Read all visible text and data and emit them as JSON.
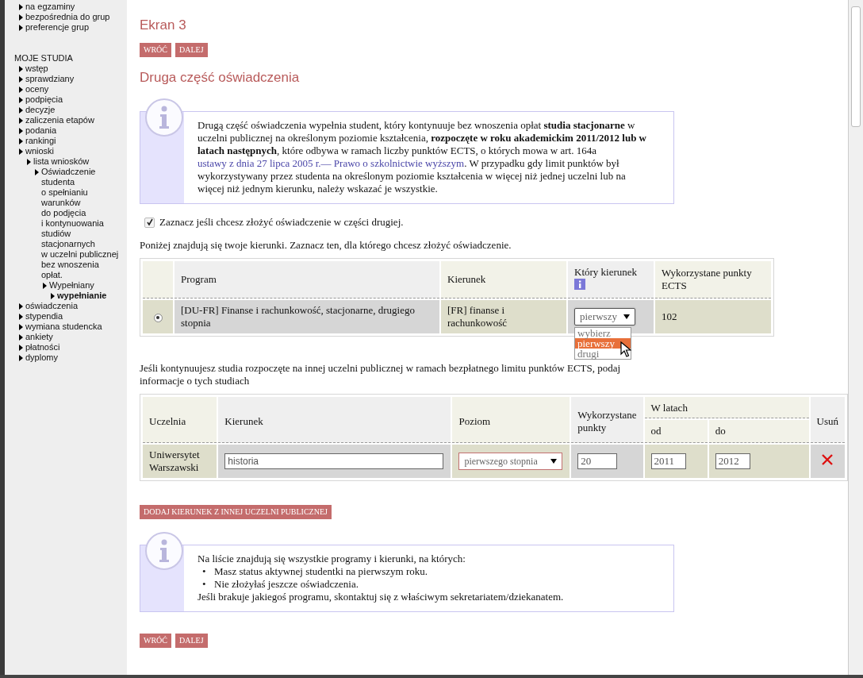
{
  "sidebar": {
    "top_items": [
      {
        "label": "na egzaminy",
        "selected": false
      },
      {
        "label": "bezpośrednia do grup",
        "selected": false
      },
      {
        "label": "preferencje grup",
        "selected": false
      }
    ],
    "section_title": "MOJE STUDIA",
    "items": [
      {
        "label": "wstęp",
        "selected": false
      },
      {
        "label": "sprawdziany",
        "selected": false
      },
      {
        "label": "oceny",
        "selected": false
      },
      {
        "label": "podpięcia",
        "selected": false
      },
      {
        "label": "decyzje",
        "selected": false
      },
      {
        "label": "zaliczenia etapów",
        "selected": false
      },
      {
        "label": "podania",
        "selected": false
      },
      {
        "label": "rankingi",
        "selected": false
      },
      {
        "label": "wnioski",
        "selected": false,
        "children": [
          {
            "label": "lista wniosków",
            "selected": false,
            "children": [
              {
                "label": "Oświadczenie studenta o spełnianiu warunków do podjęcia i kontynuowania studiów stacjonarnych w uczelni publicznej bez wnoszenia opłat.",
                "selected": false,
                "children": [
                  {
                    "label": "Wypełniany",
                    "selected": false,
                    "children": [
                      {
                        "label": "wypełnianie",
                        "selected": true
                      }
                    ]
                  }
                ]
              }
            ]
          }
        ]
      },
      {
        "label": "oświadczenia",
        "selected": false
      },
      {
        "label": "stypendia",
        "selected": false
      },
      {
        "label": "wymiana studencka",
        "selected": false
      },
      {
        "label": "ankiety",
        "selected": false
      },
      {
        "label": "płatności",
        "selected": false
      },
      {
        "label": "dyplomy",
        "selected": false
      }
    ]
  },
  "main": {
    "title": "Ekran 3",
    "top_buttons": [
      "WRÓĆ",
      "DALEJ"
    ],
    "heading": "Druga część oświadczenia",
    "info_box": {
      "parts": [
        {
          "kind": "text",
          "text": "Drugą część oświadczenia wypełnia student, który kontynuuje bez wnoszenia opłat **studia stacjonarne** w uczelni publicznej na określonym poziomie kształcenia, **rozpoczęte w roku akademickim 2011/2012 lub w latach następnych**, które odbywa w ramach liczby punktów ECTS, o których mowa w art. 164a "
        },
        {
          "kind": "link",
          "text": "ustawy z dnia 27 lipca 2005 r.— Prawo o szkolnictwie wyższym"
        },
        {
          "kind": "text",
          "text": ". W przypadku gdy limit punktów był wykorzystywany przez studenta na określonym poziomie kształcenia w więcej niż jednej uczelni lub na więcej niż jednym kierunku, należy wskazać je wszystkie."
        }
      ]
    },
    "consent": {
      "label": "Zaznacz jeśli chcesz złożyć oświadczenie w części drugiej.",
      "checked": true
    },
    "programs_intro": "Poniżej znajdują się twoje kierunki. Zaznacz ten, dla którego chcesz złożyć oświadczenie.",
    "programs_table": {
      "columns": [
        {
          "label": "Program"
        },
        {
          "label": "Kierunek"
        },
        {
          "label": "Który kierunek",
          "info": true
        },
        {
          "label": "Wykorzystane punkty ECTS"
        }
      ],
      "rows": [
        {
          "selected": true,
          "program": "[DU-FR] Finanse i rachunkowość, stacjonarne, drugiego stopnia",
          "kierunek": "[FR] finanse i rachunkowość",
          "which": {
            "value": "pierwszy",
            "open": true,
            "options": [
              {
                "label": "wybierz",
                "selected": false
              },
              {
                "label": "pierwszy",
                "selected": true
              },
              {
                "label": "drugi",
                "selected": false
              }
            ]
          },
          "points": "102"
        }
      ]
    },
    "other_intro": "Jeśli kontynuujesz studia rozpoczęte na innej uczelni publicznej w ramach bezpłatnego limitu punktów ECTS, podaj informacje o tych studiach",
    "other_table": {
      "columns": [
        {
          "label": "Uczelnia"
        },
        {
          "label": "Kierunek"
        },
        {
          "label": "Poziom"
        },
        {
          "label": "Wykorzystane punkty"
        },
        {
          "label": "W latach",
          "children": [
            {
              "label": "od"
            },
            {
              "label": "do"
            }
          ]
        },
        {
          "label": "Usuń"
        }
      ],
      "rows": [
        {
          "uczelnia": "Uniwersytet Warszawski",
          "kierunek": "historia",
          "poziom": "pierwszego stopnia",
          "punkty": "20",
          "od": "2011",
          "do": "2012"
        }
      ]
    },
    "add_button": "DODAJ KIERUNEK Z INNEJ UCZELNI PUBLICZNEJ",
    "info_box2": {
      "intro": "Na liście znajdują się wszystkie programy i kierunki, na których:",
      "bullets": [
        {
          "marker": "•",
          "text": "Masz status aktywnej studentki na pierwszym roku."
        },
        {
          "marker": "•",
          "text": "Nie złożyłaś jeszcze oświadczenia."
        }
      ],
      "footer": "Jeśli brakuje jakiegoś programu, skontaktuj się z właściwym sekretariatem/dziekanatem."
    },
    "bottom_buttons": [
      "WRÓĆ",
      "DALEJ"
    ]
  }
}
